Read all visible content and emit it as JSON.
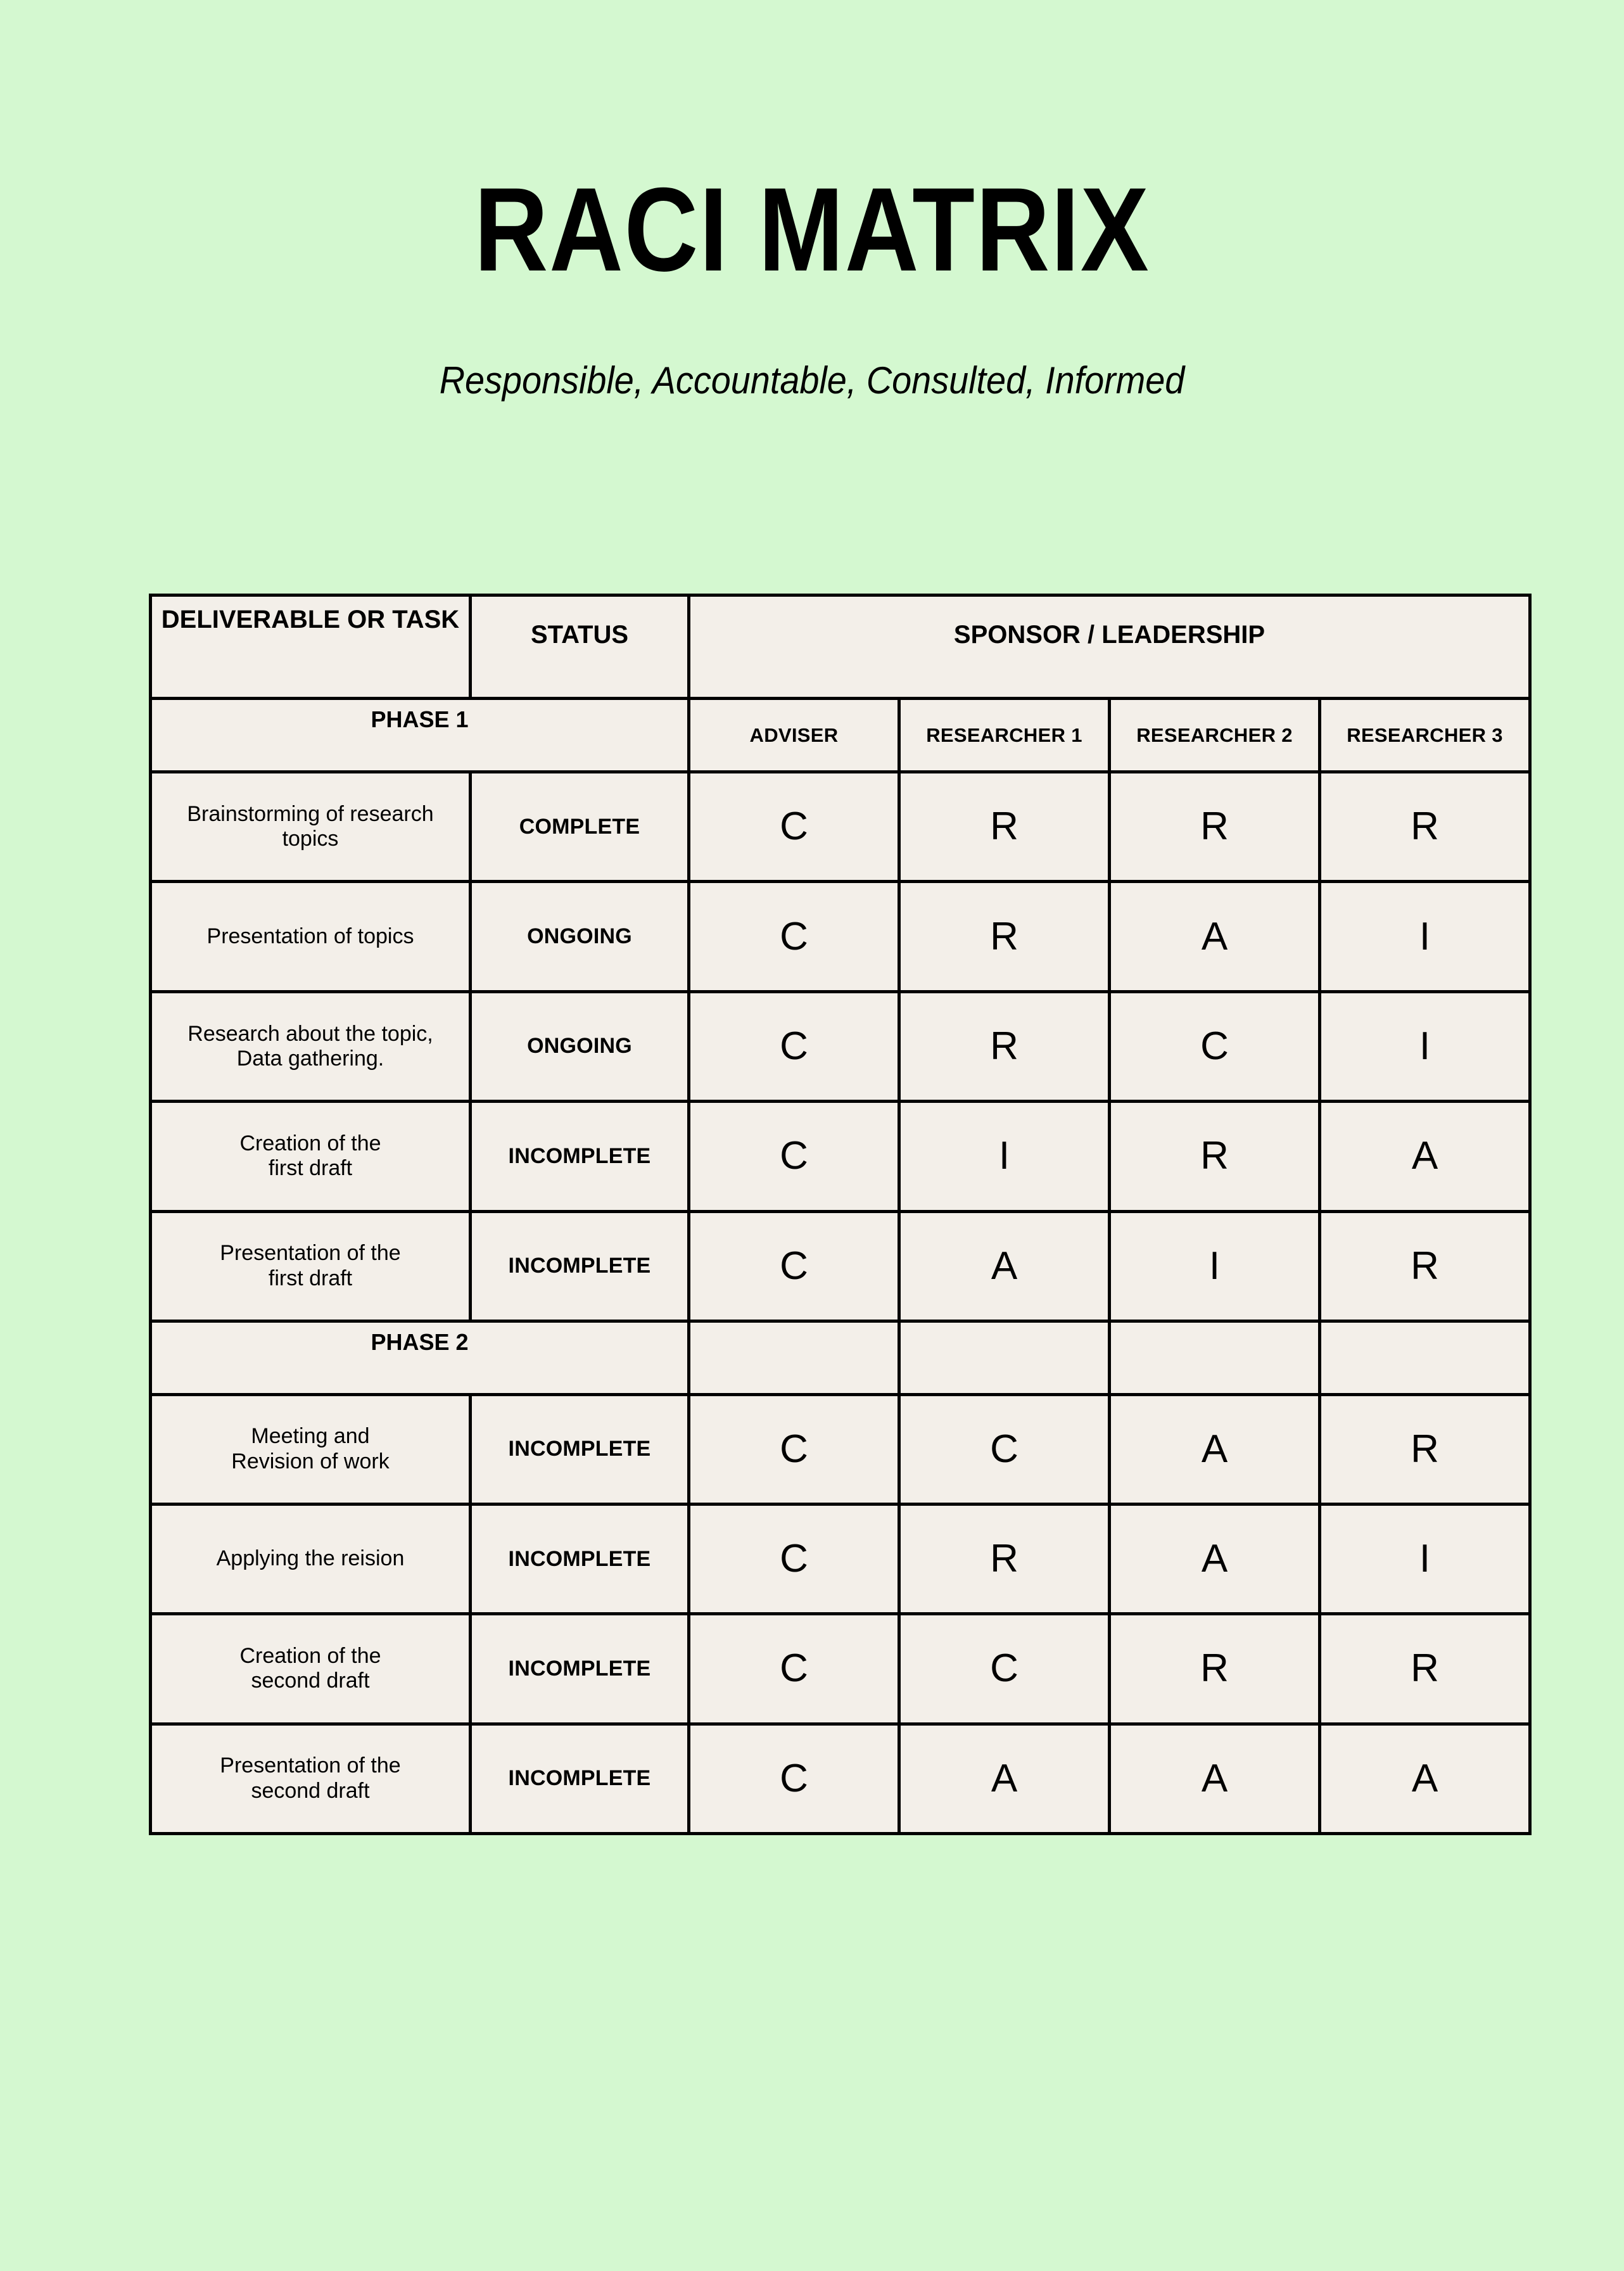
{
  "document": {
    "title": "RACI MATRIX",
    "subtitle": "Responsible, Accountable, Consulted, Informed",
    "background_color": "#d4f8d0",
    "cell_color": "#f3efe9",
    "border_color": "#000000"
  },
  "table": {
    "header": {
      "deliverable": "DELIVERABLE OR TASK",
      "status": "STATUS",
      "sponsor": "SPONSOR / LEADERSHIP"
    },
    "roles": [
      "ADVISER",
      "RESEARCHER 1",
      "RESEARCHER 2",
      "RESEARCHER 3"
    ],
    "phases": [
      {
        "label": "PHASE 1",
        "rows": [
          {
            "task": "Brainstorming of research\ntopics",
            "status": "COMPLETE",
            "raci": [
              "C",
              "R",
              "R",
              "R"
            ]
          },
          {
            "task": "Presentation of topics",
            "status": "ONGOING",
            "raci": [
              "C",
              "R",
              "A",
              "I"
            ]
          },
          {
            "task": "Research about the topic,\nData gathering.",
            "status": "ONGOING",
            "raci": [
              "C",
              "R",
              "C",
              "I"
            ]
          },
          {
            "task": "Creation of the\nfirst draft",
            "status": "INCOMPLETE",
            "raci": [
              "C",
              "I",
              "R",
              "A"
            ]
          },
          {
            "task": "Presentation  of the\nfirst draft",
            "status": "INCOMPLETE",
            "raci": [
              "C",
              "A",
              "I",
              "R"
            ]
          }
        ]
      },
      {
        "label": "PHASE 2",
        "rows": [
          {
            "task": "Meeting and\nRevision of work",
            "status": "INCOMPLETE",
            "raci": [
              "C",
              "C",
              "A",
              "R"
            ]
          },
          {
            "task": "Applying the reision",
            "status": "INCOMPLETE",
            "raci": [
              "C",
              "R",
              "A",
              "I"
            ]
          },
          {
            "task": "Creation of the\nsecond draft",
            "status": "INCOMPLETE",
            "raci": [
              "C",
              "C",
              "R",
              "R"
            ]
          },
          {
            "task": "Presentation of the\nsecond draft",
            "status": "INCOMPLETE",
            "raci": [
              "C",
              "A",
              "A",
              "A"
            ]
          }
        ]
      }
    ]
  }
}
